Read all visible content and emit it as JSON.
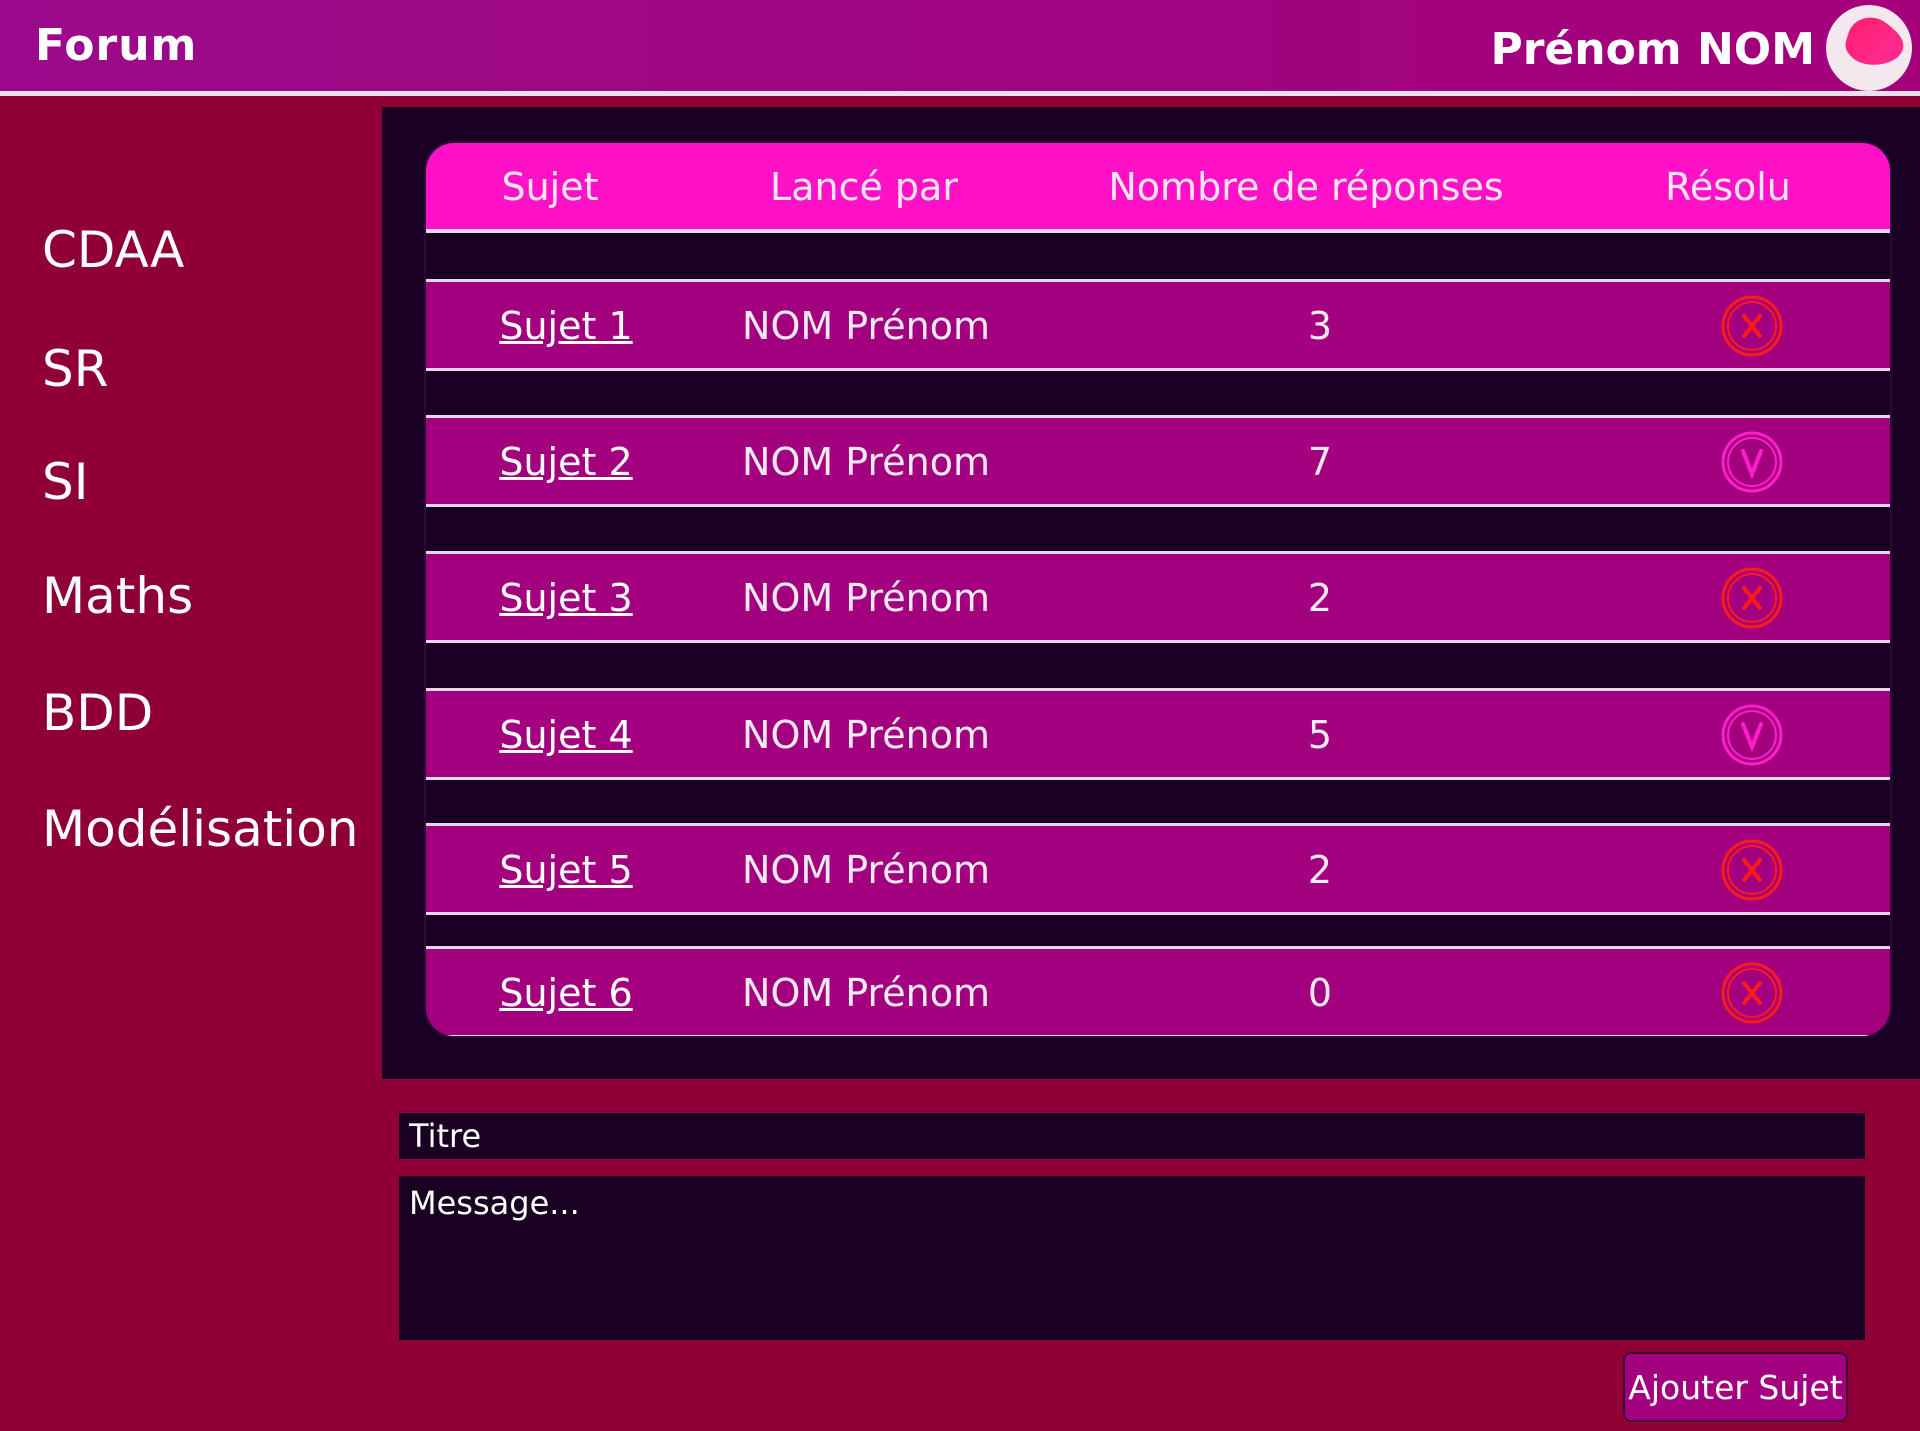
{
  "header": {
    "app_title": "Forum",
    "user_name": "Prénom NOM"
  },
  "sidebar": {
    "items": [
      {
        "label": "CDAA"
      },
      {
        "label": "SR"
      },
      {
        "label": "SI"
      },
      {
        "label": "Maths"
      },
      {
        "label": "BDD"
      },
      {
        "label": "Modélisation"
      }
    ]
  },
  "table": {
    "columns": [
      "Sujet",
      "Lancé par",
      "Nombre de réponses",
      "Résolu"
    ],
    "rows": [
      {
        "subject": "Sujet 1",
        "author": "NOM Prénom",
        "replies": "3",
        "resolved_icon": "x"
      },
      {
        "subject": "Sujet 2",
        "author": "NOM Prénom",
        "replies": "7",
        "resolved_icon": "v"
      },
      {
        "subject": "Sujet 3",
        "author": "NOM Prénom",
        "replies": "2",
        "resolved_icon": "x"
      },
      {
        "subject": "Sujet 4",
        "author": "NOM Prénom",
        "replies": "5",
        "resolved_icon": "v"
      },
      {
        "subject": "Sujet 5",
        "author": "NOM Prénom",
        "replies": "2",
        "resolved_icon": "x"
      },
      {
        "subject": "Sujet 6",
        "author": "NOM Prénom",
        "replies": "0",
        "resolved_icon": "x"
      }
    ]
  },
  "form": {
    "title_placeholder": "Titre",
    "message_placeholder": "Message...",
    "submit_label": "Ajouter Sujet"
  },
  "colors": {
    "header": "#a4007a",
    "background": "#8f0036",
    "panel": "#1a0022",
    "table_header": "#ff12c7",
    "row": "#a3007f",
    "icon_unresolved": "#ff1a1a",
    "icon_resolved": "#ff1ec8"
  }
}
